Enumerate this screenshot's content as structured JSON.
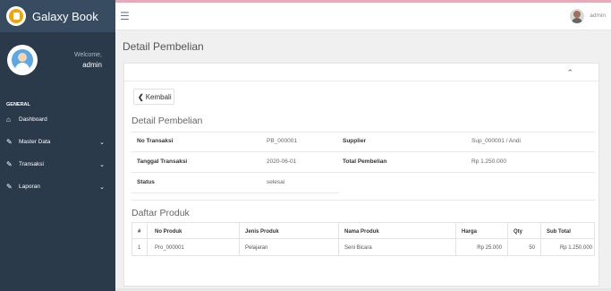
{
  "brand": {
    "name": "Galaxy Book"
  },
  "user": {
    "welcome": "Welcome,",
    "name": "admin"
  },
  "sidebar": {
    "heading": "GENERAL",
    "items": [
      {
        "label": "Dashboard",
        "icon": "home-icon"
      },
      {
        "label": "Master Data",
        "icon": "edit-icon"
      },
      {
        "label": "Transaksi",
        "icon": "edit-icon"
      },
      {
        "label": "Laporan",
        "icon": "edit-icon"
      }
    ]
  },
  "header": {
    "admin_name": "admin"
  },
  "page": {
    "title": "Detail Pembelian"
  },
  "card": {
    "back_label": "Kembali",
    "section_title": "Detail Pembelian",
    "details": {
      "no_transaksi_label": "No Transaksi",
      "no_transaksi_value": "PB_000001",
      "supplier_label": "Supplier",
      "supplier_value": "Sup_000001 / Andi",
      "tanggal_label": "Tanggal Transaksi",
      "tanggal_value": "2020-06-01",
      "total_label": "Total Pembelian",
      "total_value": "Rp 1.250.000",
      "status_label": "Status",
      "status_value": "selesai"
    },
    "products_title": "Daftar Produk",
    "products": {
      "headers": [
        "#",
        "No Produk",
        "Jenis Produk",
        "Nama Produk",
        "Harga",
        "Qty",
        "Sub Total"
      ],
      "rows": [
        [
          "1",
          "Pro_000001",
          "Pelajaran",
          "Seni Bicara",
          "Rp 25.000",
          "50",
          "Rp 1.250.000"
        ]
      ]
    }
  },
  "colors": {
    "sidebar": "#2b3a4a",
    "brand_bar": "#374c61",
    "accent_top": "#e9a9b9"
  }
}
